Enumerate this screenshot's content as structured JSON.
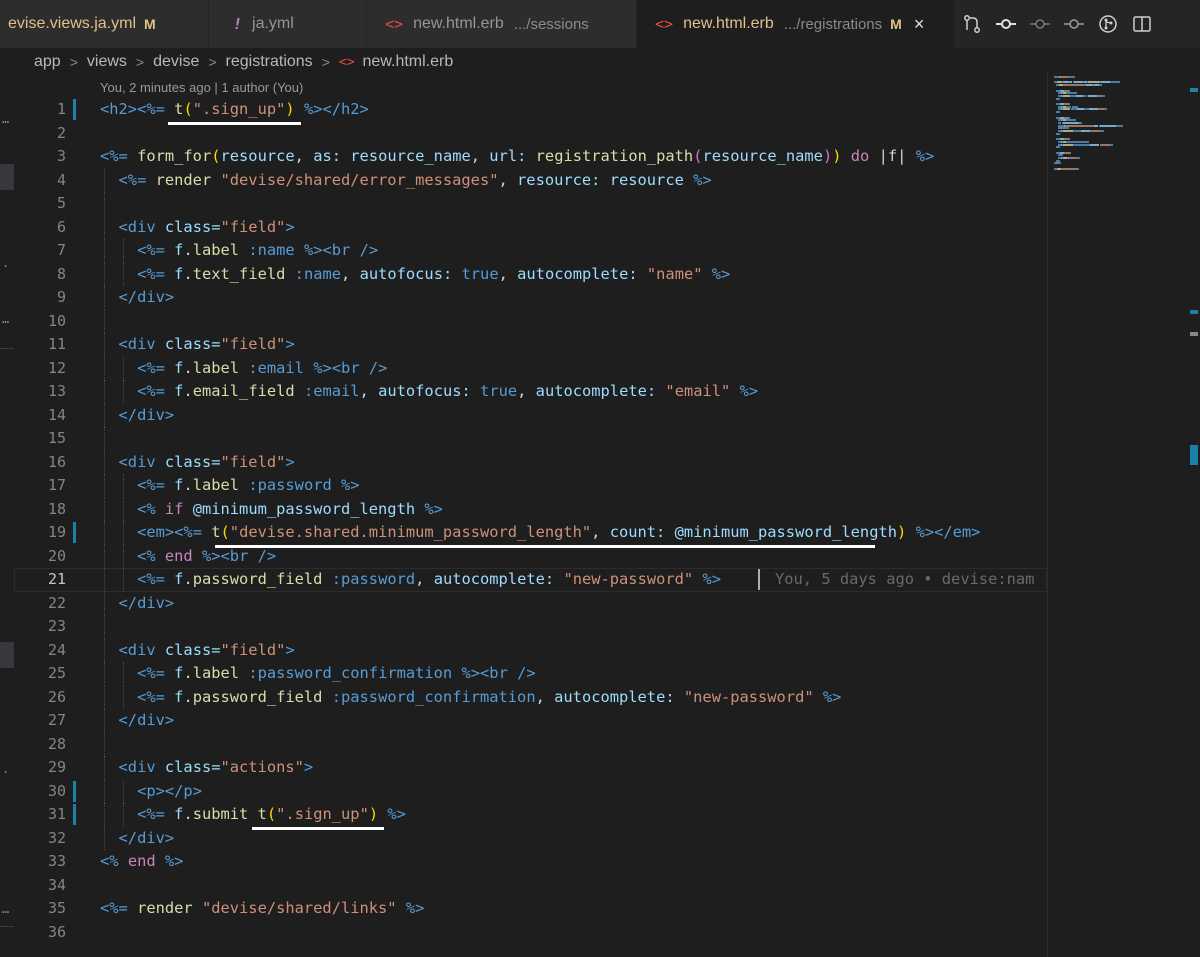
{
  "tabs": [
    {
      "title": "evise.views.ja.yml",
      "modified": "M",
      "icon": "yml-icon"
    },
    {
      "title": "ja.yml",
      "glyph": "!",
      "icon": "yml-icon"
    },
    {
      "title": "new.html.erb",
      "description": ".../sessions",
      "glyph": "<>",
      "icon": "html-file-icon"
    },
    {
      "title": "new.html.erb",
      "description": ".../registrations",
      "modified": "M",
      "glyph": "<>",
      "close": "×",
      "icon": "html-file-icon"
    }
  ],
  "editor_actions": [
    "source-control-icon",
    "git-commit-icon",
    "git-compare-icon",
    "git-next-icon",
    "git-graph-icon",
    "split-editor-icon"
  ],
  "breadcrumb": {
    "items": [
      "app",
      "views",
      "devise",
      "registrations",
      "new.html.erb"
    ],
    "separator": ">",
    "file_glyph": "<>"
  },
  "codelens": "You, 2 minutes ago | 1 author (You)",
  "blame": "You, 5 days ago • devise:nam",
  "lines": [
    {
      "n": "1"
    },
    {
      "n": "2"
    },
    {
      "n": "3"
    },
    {
      "n": "4"
    },
    {
      "n": "5"
    },
    {
      "n": "6"
    },
    {
      "n": "7"
    },
    {
      "n": "8"
    },
    {
      "n": "9"
    },
    {
      "n": "10"
    },
    {
      "n": "11"
    },
    {
      "n": "12"
    },
    {
      "n": "13"
    },
    {
      "n": "14"
    },
    {
      "n": "15"
    },
    {
      "n": "16"
    },
    {
      "n": "17"
    },
    {
      "n": "18"
    },
    {
      "n": "19"
    },
    {
      "n": "20"
    },
    {
      "n": "21"
    },
    {
      "n": "22"
    },
    {
      "n": "23"
    },
    {
      "n": "24"
    },
    {
      "n": "25"
    },
    {
      "n": "26"
    },
    {
      "n": "27"
    },
    {
      "n": "28"
    },
    {
      "n": "29"
    },
    {
      "n": "30"
    },
    {
      "n": "31"
    },
    {
      "n": "32"
    },
    {
      "n": "33"
    },
    {
      "n": "34"
    },
    {
      "n": "35"
    },
    {
      "n": "36"
    }
  ],
  "code": {
    "l1": [
      "<h2>",
      "<%= ",
      "t",
      "(",
      "\".sign_up\"",
      ")",
      " %>",
      "</h2>"
    ],
    "l3": [
      "<%= ",
      "form_for",
      "(",
      "resource",
      ", ",
      "as:",
      " ",
      "resource_name",
      ", ",
      "url:",
      " ",
      "registration_path",
      "(",
      "resource_name",
      ")",
      ")",
      " ",
      "do",
      " ",
      "|f|",
      " ",
      "%>"
    ],
    "l4": [
      "<%= ",
      "render",
      " ",
      "\"devise/shared/error_messages\"",
      ", ",
      "resource:",
      " ",
      "resource",
      " ",
      "%>"
    ],
    "l6": [
      "<div",
      " ",
      "class=",
      "\"field\"",
      ">"
    ],
    "l7": [
      "<%= ",
      "f",
      ".",
      "label",
      " ",
      ":name",
      " ",
      "%>",
      "<br",
      " />"
    ],
    "l8": [
      "<%= ",
      "f",
      ".",
      "text_field",
      " ",
      ":name",
      ", ",
      "autofocus:",
      " ",
      "true",
      ", ",
      "autocomplete:",
      " ",
      "\"name\"",
      " ",
      "%>"
    ],
    "l9": [
      "</div>"
    ],
    "l11": [
      "<div",
      " ",
      "class=",
      "\"field\"",
      ">"
    ],
    "l12": [
      "<%= ",
      "f",
      ".",
      "label",
      " ",
      ":email",
      " ",
      "%>",
      "<br",
      " />"
    ],
    "l13": [
      "<%= ",
      "f",
      ".",
      "email_field",
      " ",
      ":email",
      ", ",
      "autofocus:",
      " ",
      "true",
      ", ",
      "autocomplete:",
      " ",
      "\"email\"",
      " ",
      "%>"
    ],
    "l14": [
      "</div>"
    ],
    "l16": [
      "<div",
      " ",
      "class=",
      "\"field\"",
      ">"
    ],
    "l17": [
      "<%= ",
      "f",
      ".",
      "label",
      " ",
      ":password",
      " ",
      "%>"
    ],
    "l18": [
      "<% ",
      "if",
      " ",
      "@minimum_password_length",
      " ",
      "%>"
    ],
    "l19": [
      "<em>",
      "<%= ",
      "t",
      "(",
      "\"devise.shared.minimum_password_length\"",
      ", ",
      "count:",
      " ",
      "@minimum_password_length",
      ")",
      " ",
      "%>",
      "</em>"
    ],
    "l20": [
      "<% ",
      "end",
      " ",
      "%>",
      "<br",
      " />"
    ],
    "l21": [
      "<%= ",
      "f",
      ".",
      "password_field",
      " ",
      ":password",
      ", ",
      "autocomplete:",
      " ",
      "\"new-password\"",
      " ",
      "%>"
    ],
    "l22": [
      "</div>"
    ],
    "l24": [
      "<div",
      " ",
      "class=",
      "\"field\"",
      ">"
    ],
    "l25": [
      "<%= ",
      "f",
      ".",
      "label",
      " ",
      ":password_confirmation",
      " ",
      "%>",
      "<br",
      " />"
    ],
    "l26": [
      "<%= ",
      "f",
      ".",
      "password_field",
      " ",
      ":password_confirmation",
      ", ",
      "autocomplete:",
      " ",
      "\"new-password\"",
      " ",
      "%>"
    ],
    "l27": [
      "</div>"
    ],
    "l29": [
      "<div",
      " ",
      "class=",
      "\"actions\"",
      ">"
    ],
    "l30": [
      "<p>",
      "</p>"
    ],
    "l31": [
      "<%= ",
      "f",
      ".",
      "submit",
      " ",
      "t",
      "(",
      "\".sign_up\"",
      ")",
      " ",
      "%>"
    ],
    "l32": [
      "</div>"
    ],
    "l33": [
      "<% ",
      "end",
      " ",
      "%>"
    ],
    "l35": [
      "<%= ",
      "render",
      " ",
      "\"devise/shared/links\"",
      " ",
      "%>"
    ]
  },
  "colors": {
    "tag": "#569cd6",
    "attr": "#9cdcfe",
    "string": "#ce9178",
    "function": "#dcdcaa",
    "keyword": "#c586c0",
    "bracket_gold": "#ffd700",
    "git_modified": "#1b81a8",
    "underline": "#ffffff"
  }
}
